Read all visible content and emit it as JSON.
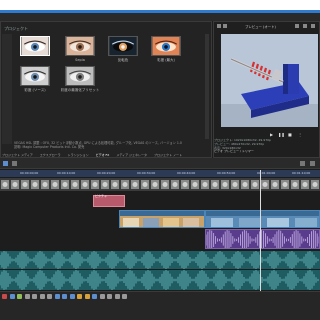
{
  "fx_panel": {
    "header": "プロジェクト",
    "thumbnails": [
      {
        "label": "",
        "tint": "#9bb6d6",
        "selected": true
      },
      {
        "label": "Sepia",
        "tint": "#c98a66",
        "selected": false
      },
      {
        "label": "反転色",
        "tint": "#6fb6c8",
        "selected": false
      },
      {
        "label": "彩度 (最大)",
        "tint": "#d26a43",
        "selected": false
      },
      {
        "label": "彩度 (ソース)",
        "tint": "#8f9aa6",
        "selected": false
      },
      {
        "label": "彩度の最適化プリセット",
        "tint": "#a7a7a7",
        "selected": false
      }
    ],
    "info_line1": "VEGAS HSL 調整 : OFX, 32 ビット浮動小数点, GPU による処理可能, グループ化, VEGAS のソース, バージョン 1.0",
    "info_line2": "説明: Magix Computer Products Intl. Co. 発売",
    "tabs": [
      "プロジェクト メディア",
      "エクスプローラ",
      "トランジション",
      "ビデオ FX",
      "メディア ジェネレータ",
      "プロジェクト ノート"
    ]
  },
  "preview": {
    "toolbar_label": "プレビュー (オート)",
    "info_lines": [
      "プロジェクト: 1920x1080x32, 29.970p",
      "プレビュー: 480x270x32, 29.970p",
      "表示: 320x180x32",
      "ビデオ プレビュー / トリマー"
    ]
  },
  "timeline": {
    "timecodes": [
      "00:00:00;00",
      "00:00:10;00",
      "00:00:20;00",
      "00:00:30;00",
      "00:00:40;00",
      "00:00:50;00",
      "00:01:00;00",
      "00:01:10;00"
    ],
    "title_clip": "ピクチャ",
    "colors": {
      "title_clip": "#b85a6b",
      "video_clip": "#2d5f86",
      "effect_clip": "#5a3c8c",
      "audio_track": "#1e5c62",
      "ruler": "#2c3a55"
    }
  },
  "bottom_icons": [
    {
      "name": "record-icon",
      "color": "#c84a4a"
    },
    {
      "name": "loop-icon",
      "color": "#5b8fd0"
    },
    {
      "name": "play-icon",
      "color": "#8fbf5a"
    },
    {
      "name": "pause-icon",
      "color": "#999999"
    },
    {
      "name": "stop-icon",
      "color": "#999999"
    },
    {
      "name": "prev-frame-icon",
      "color": "#999999"
    },
    {
      "name": "next-frame-icon",
      "color": "#999999"
    },
    {
      "name": "snap-icon",
      "color": "#5b8fd0"
    },
    {
      "name": "split-icon",
      "color": "#5b8fd0"
    },
    {
      "name": "trim-icon",
      "color": "#5b8fd0"
    },
    {
      "name": "marker-icon",
      "color": "#d8a23a"
    },
    {
      "name": "region-icon",
      "color": "#d8a23a"
    },
    {
      "name": "ripple-icon",
      "color": "#5b8fd0"
    },
    {
      "name": "lock-icon",
      "color": "#999999"
    },
    {
      "name": "zoom-in-icon",
      "color": "#999999"
    },
    {
      "name": "zoom-out-icon",
      "color": "#999999"
    },
    {
      "name": "settings-icon",
      "color": "#999999"
    }
  ]
}
